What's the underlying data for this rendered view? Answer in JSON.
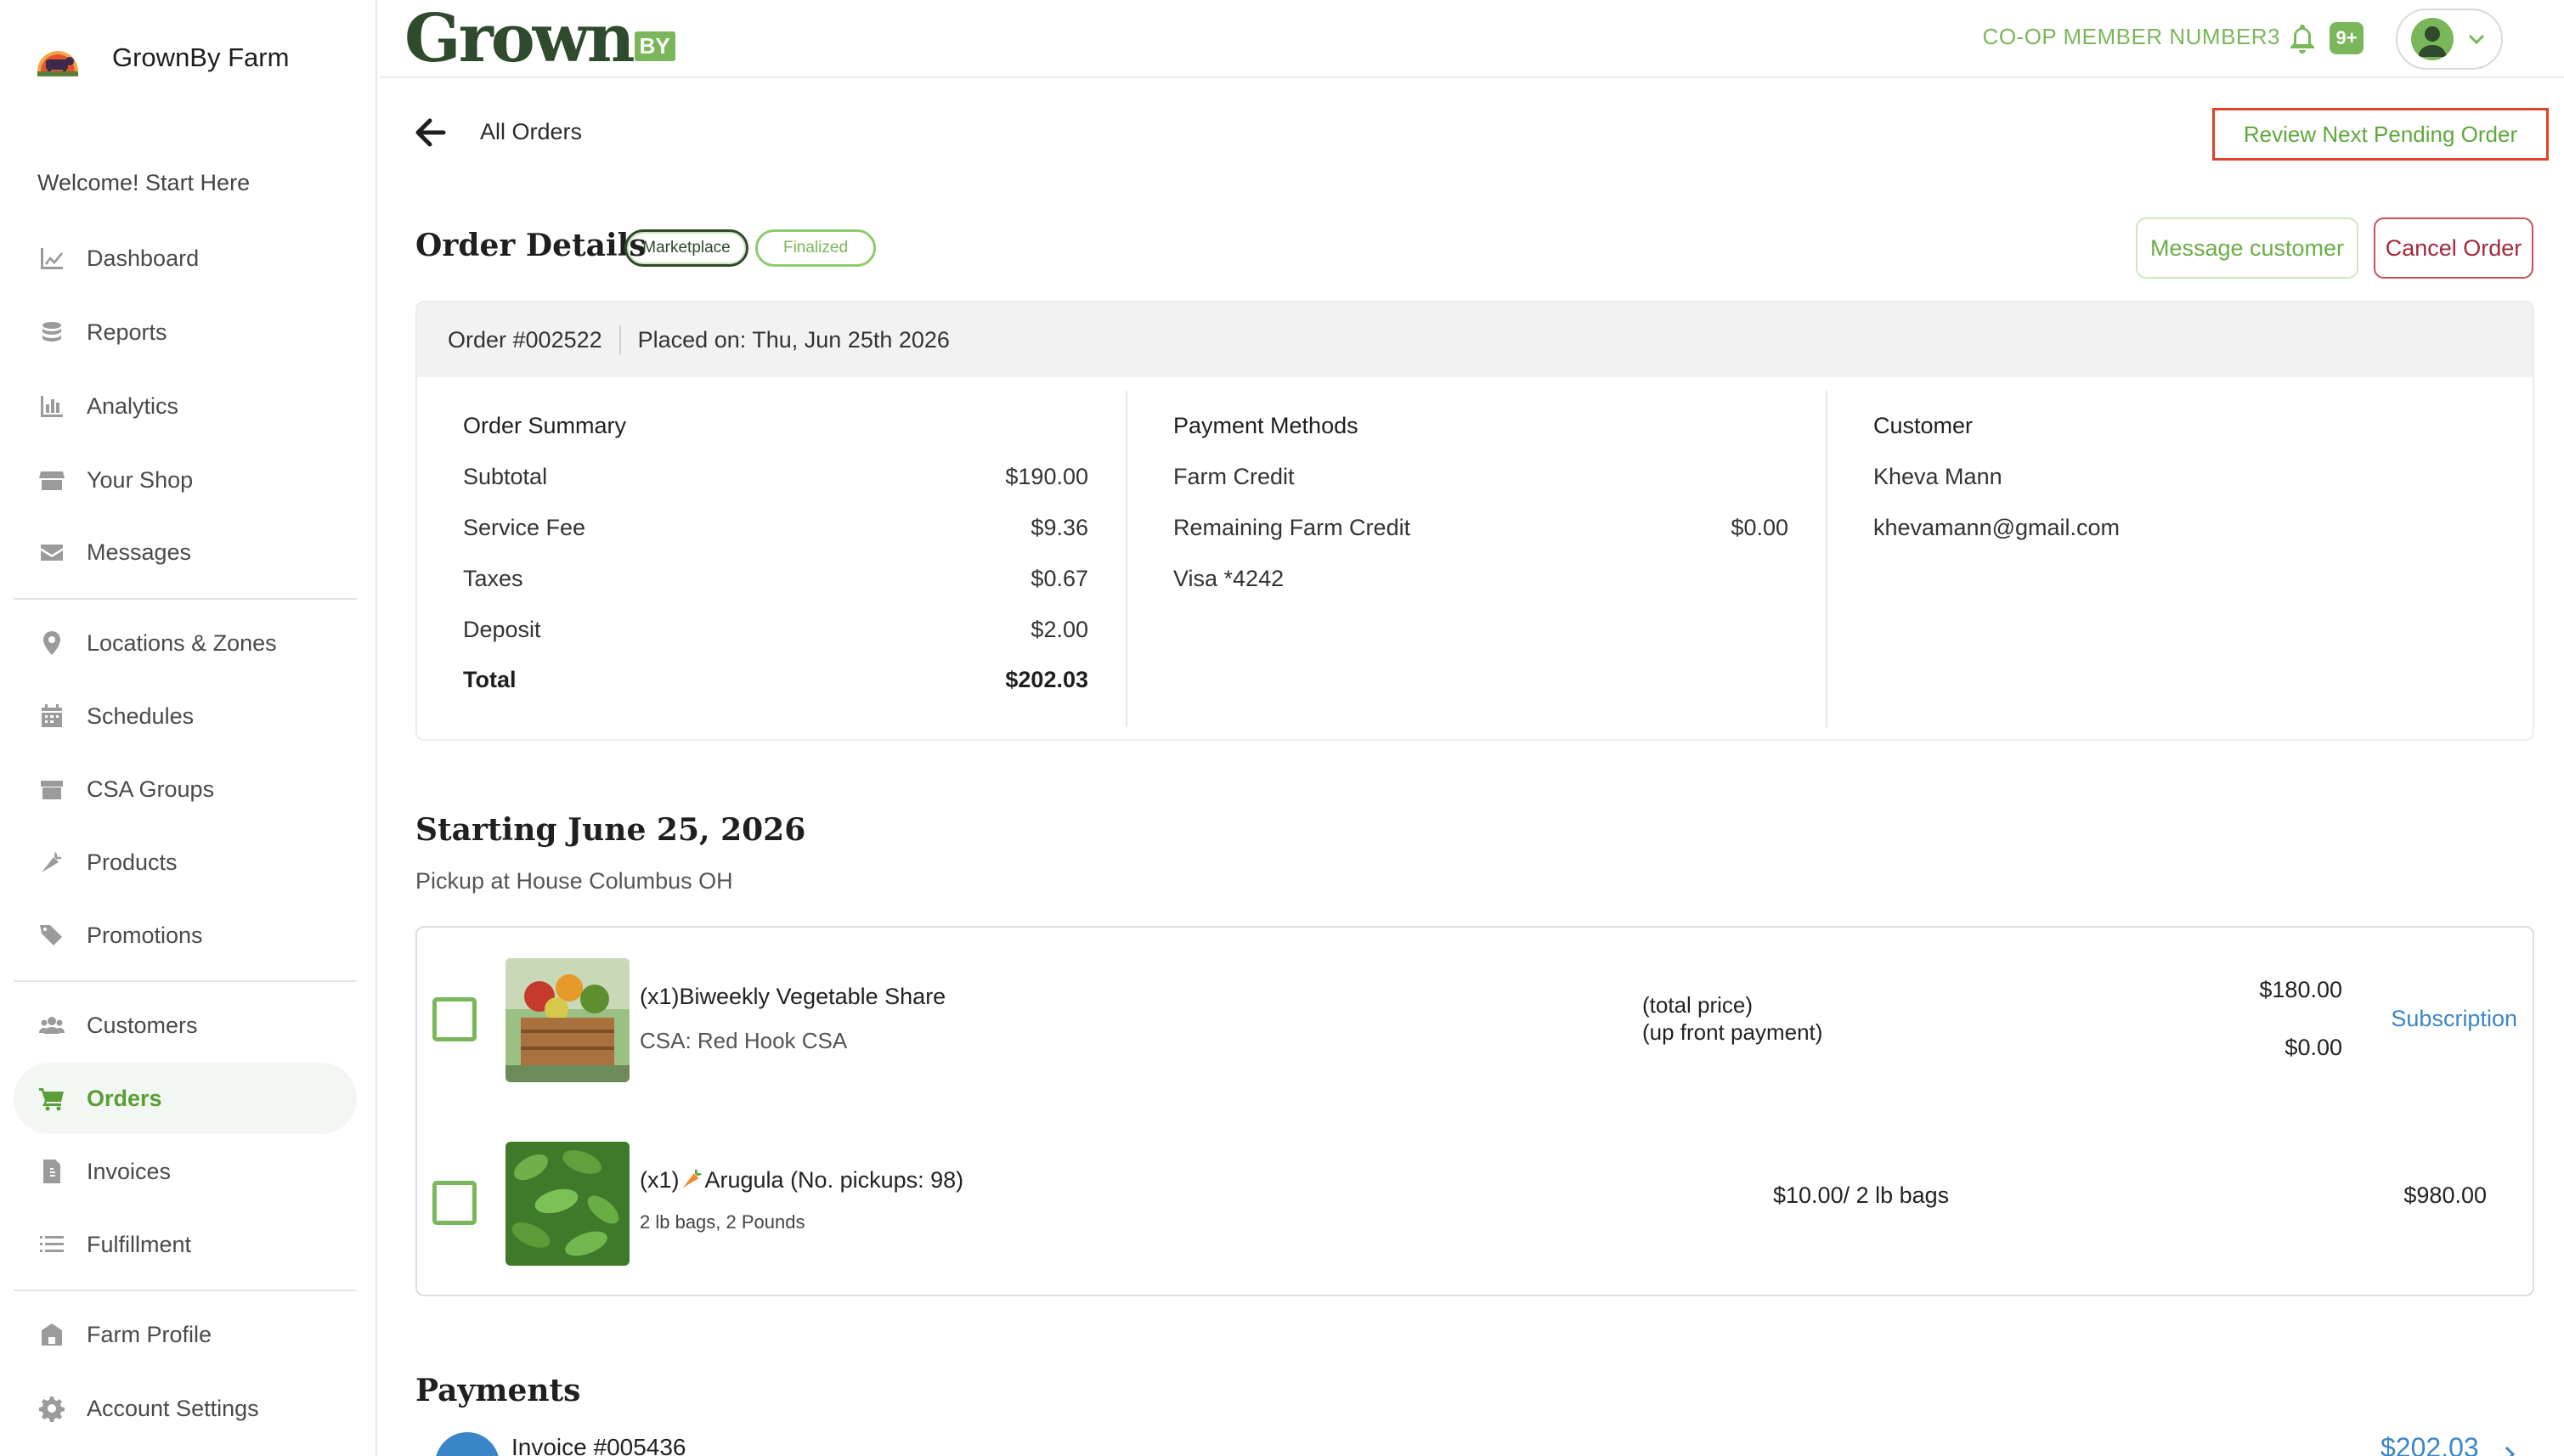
{
  "sidebar": {
    "brand": "GrownBy Farm",
    "welcome": "Welcome! Start Here",
    "items": [
      {
        "label": "Dashboard",
        "icon": "chart-line-icon"
      },
      {
        "label": "Reports",
        "icon": "coins-icon"
      },
      {
        "label": "Analytics",
        "icon": "bar-chart-icon"
      },
      {
        "label": "Your Shop",
        "icon": "store-icon"
      },
      {
        "label": "Messages",
        "icon": "envelope-icon"
      },
      {
        "label": "Locations & Zones",
        "icon": "map-pin-icon"
      },
      {
        "label": "Schedules",
        "icon": "calendar-icon"
      },
      {
        "label": "CSA Groups",
        "icon": "box-icon"
      },
      {
        "label": "Products",
        "icon": "carrot-icon"
      },
      {
        "label": "Promotions",
        "icon": "tags-icon"
      },
      {
        "label": "Customers",
        "icon": "users-icon"
      },
      {
        "label": "Orders",
        "icon": "cart-icon"
      },
      {
        "label": "Invoices",
        "icon": "invoice-icon"
      },
      {
        "label": "Fulfillment",
        "icon": "list-icon"
      },
      {
        "label": "Farm Profile",
        "icon": "barn-icon"
      },
      {
        "label": "Account Settings",
        "icon": "gear-icon"
      }
    ],
    "active": "Orders"
  },
  "header": {
    "logo_main": "Grown",
    "logo_by": "BY",
    "member": "CO-OP MEMBER NUMBER3",
    "notifications": "9+"
  },
  "nav": {
    "back_label": "All Orders",
    "review_next": "Review Next Pending Order"
  },
  "order": {
    "title": "Order Details",
    "badge_marketplace": "Marketplace",
    "badge_finalized": "Finalized",
    "message_customer": "Message customer",
    "cancel": "Cancel Order",
    "number": "Order #002522",
    "placed": "Placed on: Thu, Jun 25th 2026",
    "summary": {
      "header": "Order Summary",
      "rows": [
        {
          "label": "Subtotal",
          "value": "$190.00"
        },
        {
          "label": "Service Fee",
          "value": "$9.36"
        },
        {
          "label": "Taxes",
          "value": "$0.67"
        },
        {
          "label": "Deposit",
          "value": "$2.00"
        },
        {
          "label": "Total",
          "value": "$202.03"
        }
      ]
    },
    "payment_methods": {
      "header": "Payment Methods",
      "rows": [
        {
          "label": "Farm Credit",
          "value": ""
        },
        {
          "label": "Remaining Farm Credit",
          "value": "$0.00"
        },
        {
          "label": "Visa *4242",
          "value": ""
        }
      ]
    },
    "customer": {
      "header": "Customer",
      "name": "Kheva Mann",
      "email": "khevamann@gmail.com"
    }
  },
  "fulfillment": {
    "title": "Starting June 25, 2026",
    "pickup": "Pickup at House Columbus OH",
    "items": [
      {
        "name": "(x1)Biweekly Vegetable Share",
        "sub": "CSA: Red Hook CSA",
        "price_note_1": "(total price)",
        "price_note_2": "(up front payment)",
        "price_1": "$180.00",
        "price_2": "$0.00",
        "link": "Subscription"
      },
      {
        "name_prefix": "(x1)",
        "name": "Arugula (No. pickups: 98)",
        "sub": "2 lb bags, 2 Pounds",
        "unit_price": "$10.00/ 2 lb bags",
        "total": "$980.00"
      }
    ]
  },
  "payments": {
    "title": "Payments",
    "invoice": "Invoice #005436",
    "amount": "$202.03"
  },
  "colors": {
    "accent_green": "#7ab75a",
    "dark_green": "#2f4a2c",
    "link_blue": "#3a86c8",
    "cancel_red": "#a3283a",
    "highlight_red": "#e0412a"
  }
}
